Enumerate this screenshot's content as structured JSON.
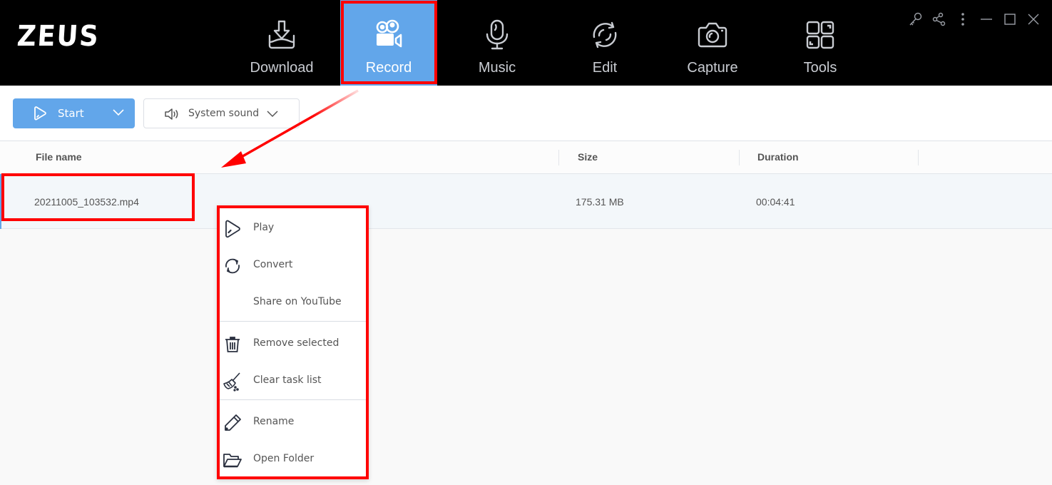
{
  "app": {
    "logo": "ZEUS"
  },
  "nav": {
    "tabs": [
      {
        "id": "download",
        "label": "Download",
        "icon": "download-tray-icon",
        "active": false
      },
      {
        "id": "record",
        "label": "Record",
        "icon": "video-camera-icon",
        "active": true
      },
      {
        "id": "music",
        "label": "Music",
        "icon": "microphone-icon",
        "active": false
      },
      {
        "id": "edit",
        "label": "Edit",
        "icon": "sync-circle-icon",
        "active": false
      },
      {
        "id": "capture",
        "label": "Capture",
        "icon": "camera-icon",
        "active": false
      },
      {
        "id": "tools",
        "label": "Tools",
        "icon": "grid-tools-icon",
        "active": false
      }
    ]
  },
  "window_controls": [
    "key-icon",
    "share-icon",
    "more-vertical-icon",
    "minimize-icon",
    "maximize-icon",
    "close-icon"
  ],
  "toolbar": {
    "start_label": "Start",
    "sound_label": "System sound"
  },
  "table": {
    "columns": [
      "File name",
      "Size",
      "Duration"
    ],
    "rows": [
      {
        "file_name": "20211005_103532.mp4",
        "size": "175.31 MB",
        "duration": "00:04:41"
      }
    ]
  },
  "context_menu": {
    "items": [
      {
        "label": "Play",
        "icon": "play-icon"
      },
      {
        "label": "Convert",
        "icon": "convert-icon"
      },
      {
        "label": "Share on YouTube",
        "icon": ""
      },
      {
        "label": "Remove selected",
        "icon": "trash-icon"
      },
      {
        "label": "Clear task list",
        "icon": "broom-icon"
      },
      {
        "label": "Rename",
        "icon": "pencil-icon"
      },
      {
        "label": "Open Folder",
        "icon": "folder-open-icon"
      }
    ]
  },
  "colors": {
    "accent": "#62a6ea",
    "topbar": "#000000",
    "highlight": "#ff0000",
    "row_selected": "#f3f7fa"
  }
}
